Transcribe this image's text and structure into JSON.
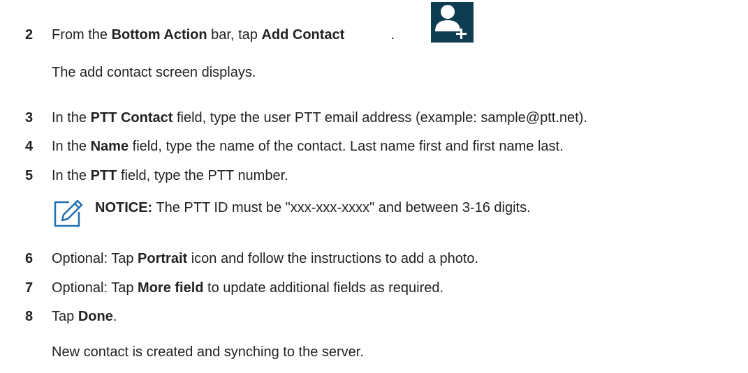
{
  "steps": [
    {
      "number": "2",
      "parts": [
        "From the ",
        "Bottom Action",
        " bar, tap ",
        "Add Contact",
        "."
      ],
      "result": "The add contact screen displays."
    },
    {
      "number": "3",
      "parts": [
        "In the ",
        "PTT Contact",
        " field, type the user PTT email address (example: sample@ptt.net)."
      ]
    },
    {
      "number": "4",
      "parts": [
        "In the ",
        "Name",
        " field, type the name of the contact. Last name first and first name last."
      ]
    },
    {
      "number": "5",
      "parts": [
        "In the ",
        "PTT",
        " field, type the PTT number."
      ]
    },
    {
      "number": "6",
      "parts": [
        "Optional: Tap ",
        "Portrait",
        " icon and follow the instructions to add a photo."
      ]
    },
    {
      "number": "7",
      "parts": [
        "Optional: Tap ",
        "More field",
        " to update additional fields as required."
      ]
    },
    {
      "number": "8",
      "parts": [
        "Tap ",
        "Done",
        "."
      ],
      "result": "New contact is created and synching to the server."
    }
  ],
  "notice": {
    "label": "NOTICE:",
    "text": " The PTT ID must be \"xxx-xxx-xxxx\" and between 3-16 digits."
  },
  "icons": {
    "add_contact": "add-contact-icon",
    "notice": "notice-pencil-icon"
  },
  "colors": {
    "text": "#222222",
    "icon_background": "#0e3d52",
    "notice_icon": "#1f6fb2"
  }
}
